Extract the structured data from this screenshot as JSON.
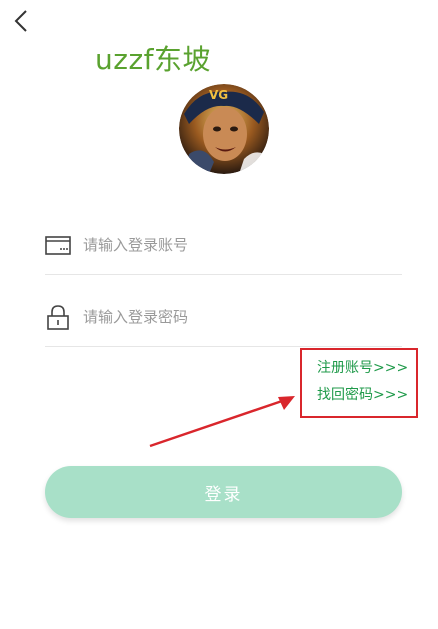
{
  "header": {
    "back_icon": "chevron-left-icon",
    "watermark": "uzzf东坡"
  },
  "avatar": {
    "alt": "user avatar"
  },
  "form": {
    "account_placeholder": "请输入登录账号",
    "account_icon": "card-icon",
    "password_placeholder": "请输入登录密码",
    "password_icon": "lock-icon"
  },
  "links": {
    "register": "注册账号>>>",
    "forgot": "找回密码>>>"
  },
  "login": {
    "label": "登录"
  },
  "colors": {
    "accent": "#a8e0c8",
    "link": "#1f9a4a",
    "annotation": "#d9262c",
    "watermark": "#5aa22f"
  }
}
